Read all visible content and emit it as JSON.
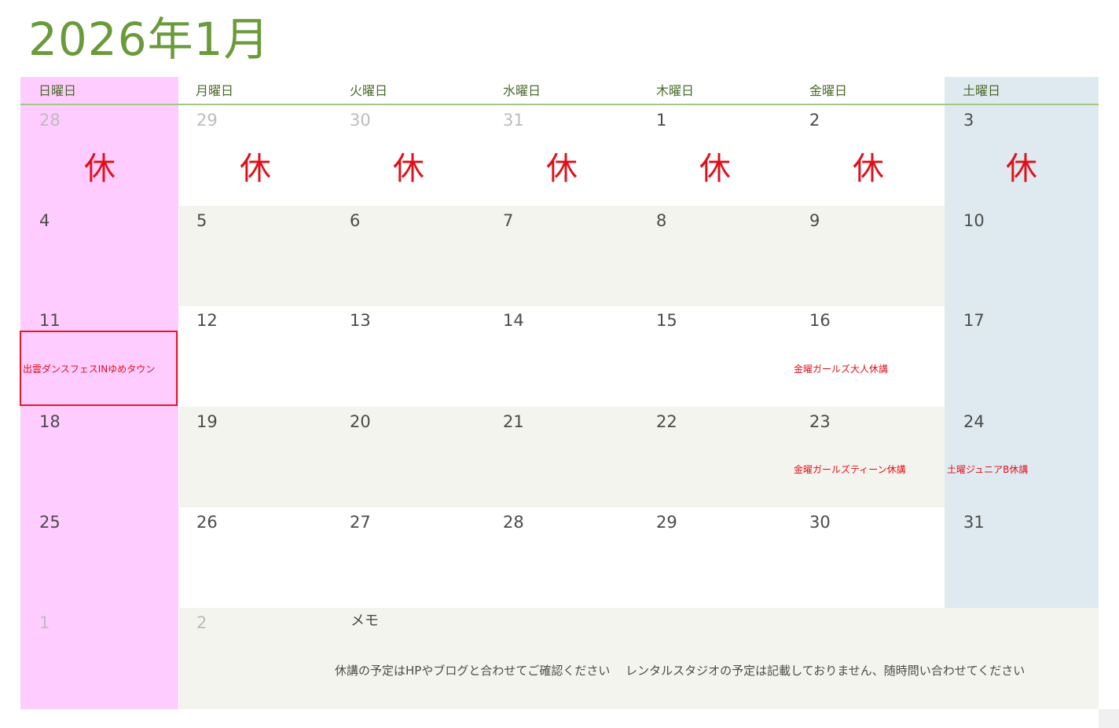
{
  "title": "2026年1月",
  "day_names": [
    "日曜日",
    "月曜日",
    "火曜日",
    "水曜日",
    "木曜日",
    "金曜日",
    "土曜日"
  ],
  "closed_mark": "休",
  "weeks": [
    {
      "days": [
        {
          "num": "28",
          "muted": true
        },
        {
          "num": "29",
          "muted": true
        },
        {
          "num": "30",
          "muted": true
        },
        {
          "num": "31",
          "muted": true
        },
        {
          "num": "1"
        },
        {
          "num": "2"
        },
        {
          "num": "3"
        }
      ]
    },
    {
      "days": [
        {
          "num": "4"
        },
        {
          "num": "5"
        },
        {
          "num": "6"
        },
        {
          "num": "7"
        },
        {
          "num": "8"
        },
        {
          "num": "9"
        },
        {
          "num": "10"
        }
      ]
    },
    {
      "days": [
        {
          "num": "11"
        },
        {
          "num": "12"
        },
        {
          "num": "13"
        },
        {
          "num": "14"
        },
        {
          "num": "15"
        },
        {
          "num": "16"
        },
        {
          "num": "17"
        }
      ]
    },
    {
      "days": [
        {
          "num": "18"
        },
        {
          "num": "19"
        },
        {
          "num": "20"
        },
        {
          "num": "21"
        },
        {
          "num": "22"
        },
        {
          "num": "23"
        },
        {
          "num": "24"
        }
      ]
    },
    {
      "days": [
        {
          "num": "25"
        },
        {
          "num": "26"
        },
        {
          "num": "27"
        },
        {
          "num": "28"
        },
        {
          "num": "29"
        },
        {
          "num": "30"
        },
        {
          "num": "31"
        }
      ]
    },
    {
      "days": [
        {
          "num": "1",
          "muted": true
        },
        {
          "num": "2",
          "muted": true
        }
      ]
    }
  ],
  "events": {
    "jan11": "出雲ダンスフェスINゆめタウン",
    "jan16": "金曜ガールズ大人休講",
    "jan23": "金曜ガールズティーン休講",
    "jan24": "土曜ジュニアB休講"
  },
  "memo": {
    "label": "メモ",
    "text": "休講の予定はHPやブログと合わせてご確認ください　 レンタルスタジオの予定は記載しておりません、随時問い合わせてください"
  },
  "colors": {
    "title": "#6b9a3a",
    "sunday_bg": "#ffccff",
    "saturday_bg": "#deeaf0",
    "band_bg": "#f4f4ee",
    "closed_red": "#e0101a"
  }
}
